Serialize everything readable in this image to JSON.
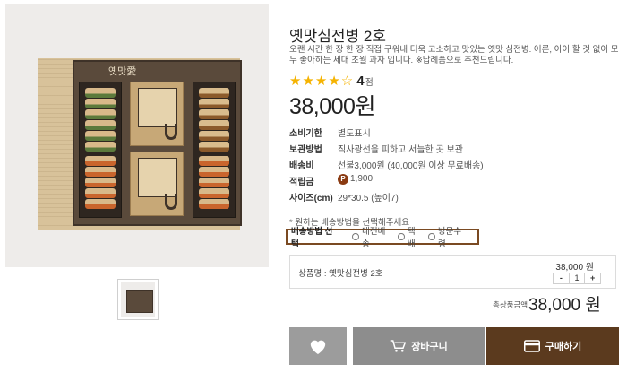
{
  "product": {
    "title": "옛맛심전병 2호",
    "description": "오랜 시간 한 장 한 장 직접 구워내 더욱 고소하고 맛있는 옛맛 심전병. 어른, 아이 할 것 없이 모두 좋아하는 세대 초월 과자 입니다. ※답례품으로 추천드립니다.",
    "rating_value": "4",
    "rating_unit": "점",
    "rating_stars_filled": 4,
    "rating_stars_total": 5,
    "price": "38,000원",
    "box_logo": "옛맛愛"
  },
  "specs": [
    {
      "key": "소비기한",
      "value": "별도표시"
    },
    {
      "key": "보관방법",
      "value": "직사광선을 피하고 서늘한 곳 보관"
    },
    {
      "key": "배송비",
      "value": "선불3,000원 (40,000원 이상 무료배송)"
    },
    {
      "key": "적립금",
      "value": "1,900",
      "icon": "P"
    },
    {
      "key": "사이즈(cm)",
      "value": "29*30.5 (높이7)"
    }
  ],
  "shipping": {
    "note": "* 원하는 배송방법을 선택해주세요",
    "label": "배송방법 선택",
    "options": [
      "대전배송",
      "택배",
      "방문수령"
    ]
  },
  "option": {
    "name": "상품명 : 옛맛심전병 2호",
    "price": "38,000 원",
    "qty_minus": "-",
    "qty_value": "1",
    "qty_plus": "+"
  },
  "total": {
    "label": "총상품금액",
    "price": "38,000 원"
  },
  "buttons": {
    "cart": "장바구니",
    "buy": "구매하기"
  },
  "colors": {
    "star": "#f5b301",
    "buy_button": "#5b3a1e",
    "cart_button": "#8d8d8d",
    "ship_border": "#7a4a22"
  }
}
